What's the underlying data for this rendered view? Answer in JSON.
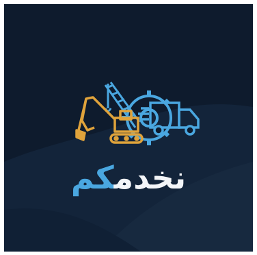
{
  "brand": {
    "name_part_white": "نخدم",
    "name_part_blue": "كم",
    "colors": {
      "background": "#0e1b2d",
      "accent_blue": "#4aa7e0",
      "accent_gold": "#e0a33b",
      "text_white": "#f3f5f8"
    }
  },
  "illustration": {
    "icons": [
      "excavator-icon",
      "crane-icon",
      "gear-icon",
      "truck-icon"
    ]
  }
}
